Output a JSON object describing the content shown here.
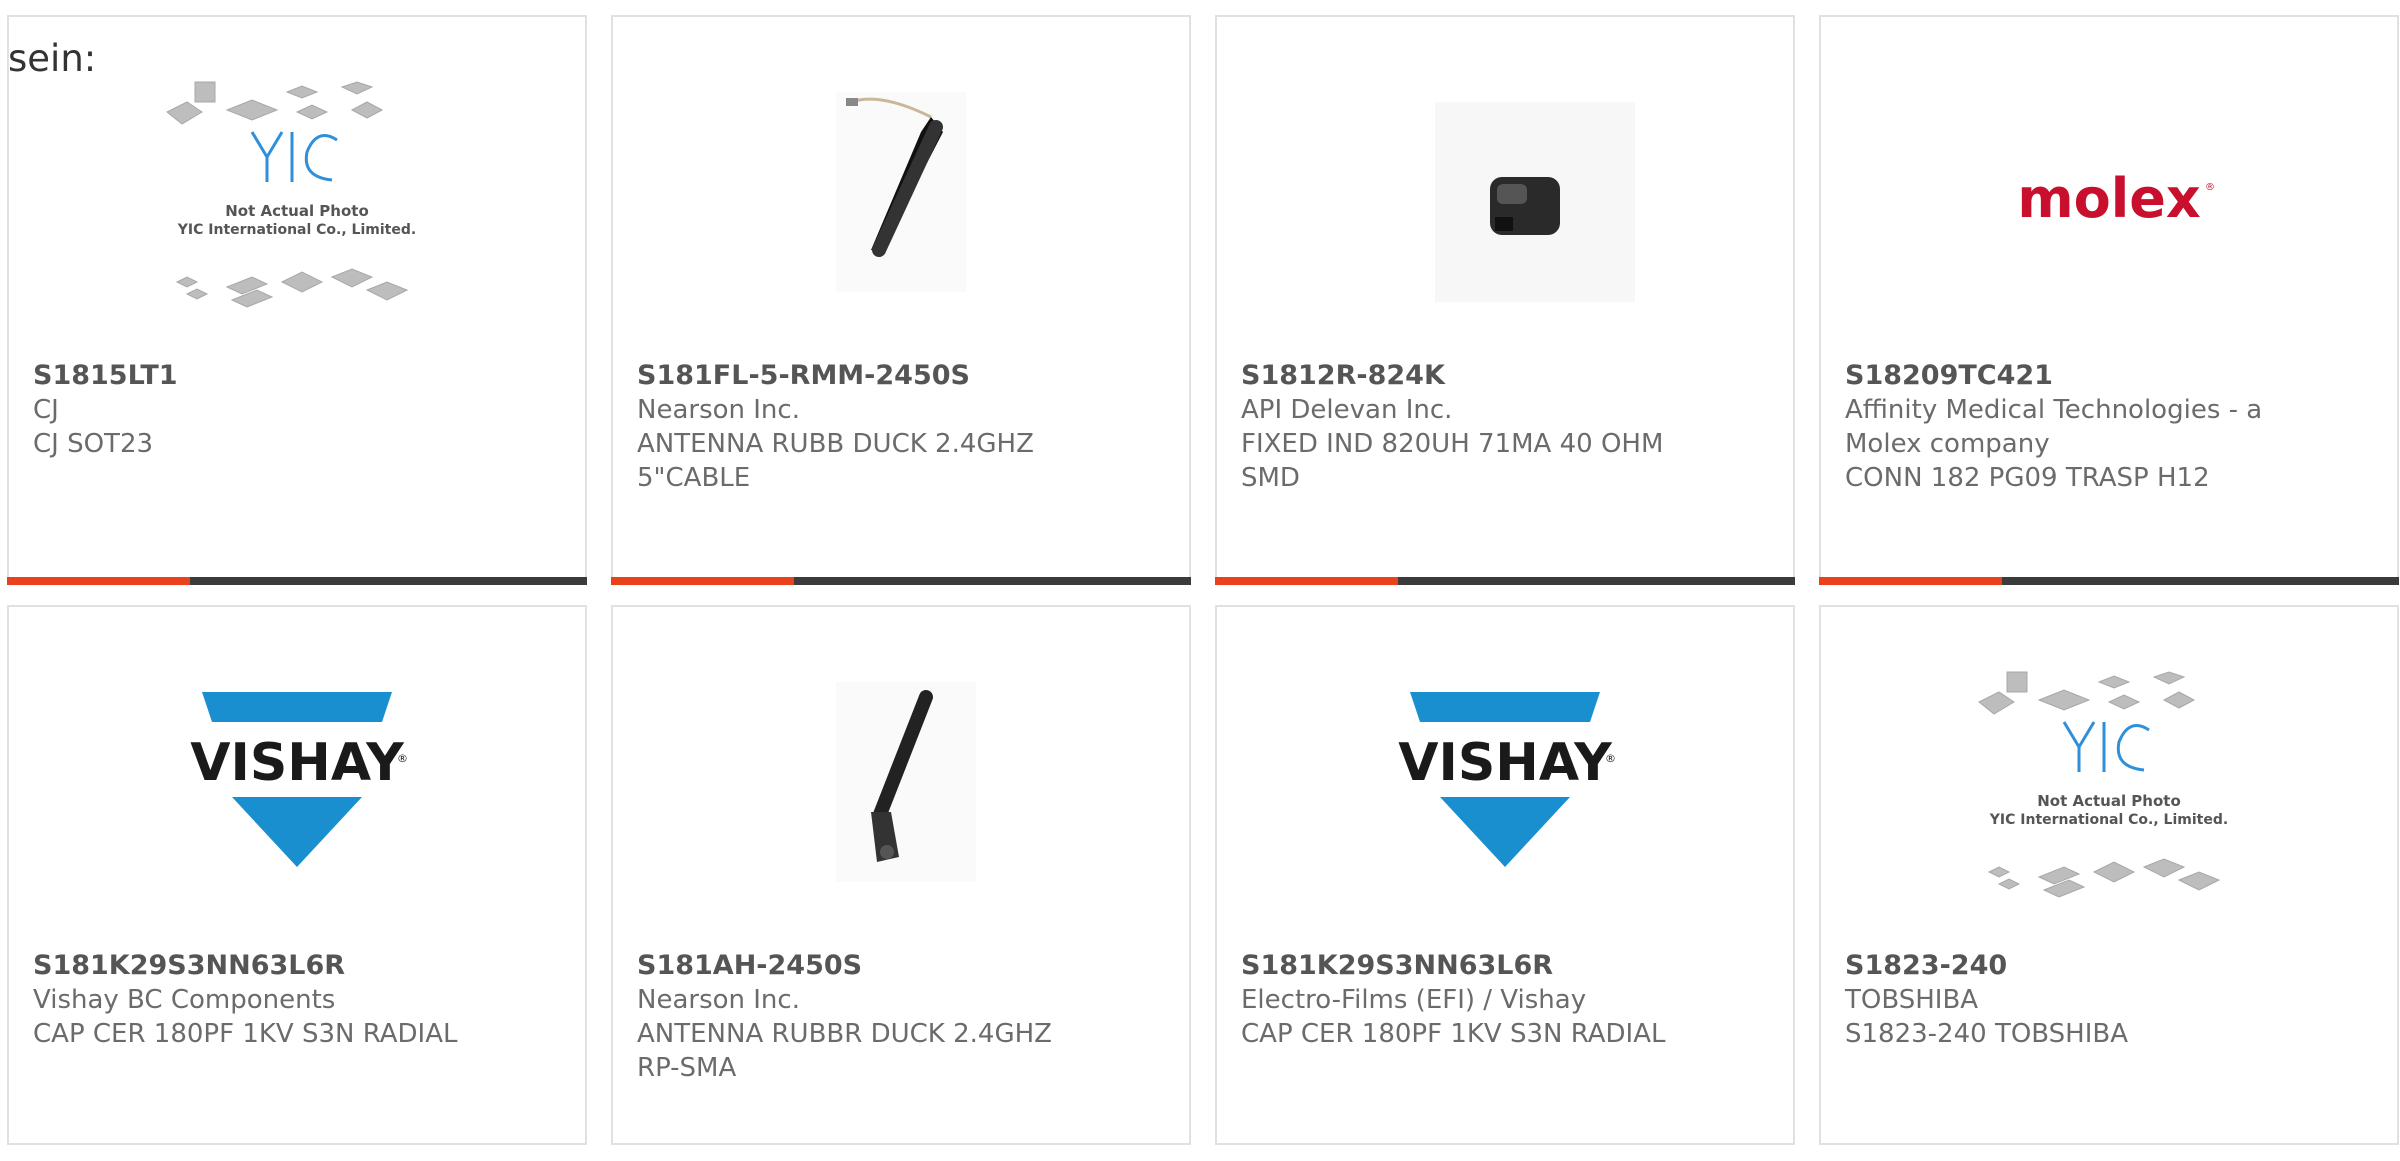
{
  "intro_text": "sein:",
  "colors": {
    "accent_red": "#e8411c",
    "accent_dark": "#3b3b3b",
    "vishay_blue": "#1a8fd0",
    "molex_red": "#c8102e",
    "yic_blue": "#2f8fd8"
  },
  "placeholder_caption": {
    "line1": "Not Actual Photo",
    "line2": "YIC International Co., Limited."
  },
  "logo_text": {
    "yic": "YIC",
    "molex": "molex",
    "vishay": "VISHAY",
    "vishay_mark": "®",
    "molex_mark": "®"
  },
  "products": [
    {
      "part_number": "S1815LT1",
      "manufacturer": "CJ",
      "description": "CJ SOT23",
      "image": "yic-placeholder-icon"
    },
    {
      "part_number": "S181FL-5-RMM-2450S",
      "manufacturer": "Nearson Inc.",
      "description": "ANTENNA RUBB DUCK 2.4GHZ 5\"CABLE",
      "image": "antenna-cable-icon"
    },
    {
      "part_number": "S1812R-824K",
      "manufacturer": "API Delevan Inc.",
      "description": "FIXED IND 820UH 71MA 40 OHM SMD",
      "image": "inductor-icon"
    },
    {
      "part_number": "S18209TC421",
      "manufacturer": "Affinity Medical Technologies - a Molex company",
      "description": "CONN 182 PG09 TRASP H12",
      "image": "molex-logo-icon"
    },
    {
      "part_number": "S181K29S3NN63L6R",
      "manufacturer": "Vishay BC Components",
      "description": "CAP CER 180PF 1KV S3N RADIAL",
      "image": "vishay-logo-icon"
    },
    {
      "part_number": "S181AH-2450S",
      "manufacturer": "Nearson Inc.",
      "description": "ANTENNA RUBBR DUCK 2.4GHZ RP-SMA",
      "image": "antenna-icon"
    },
    {
      "part_number": "S181K29S3NN63L6R",
      "manufacturer": "Electro-Films (EFI) / Vishay",
      "description": "CAP CER 180PF 1KV S3N RADIAL",
      "image": "vishay-logo-icon"
    },
    {
      "part_number": "S1823-240",
      "manufacturer": "TOBSHIBA",
      "description": "S1823-240 TOBSHIBA",
      "image": "yic-placeholder-icon"
    }
  ]
}
